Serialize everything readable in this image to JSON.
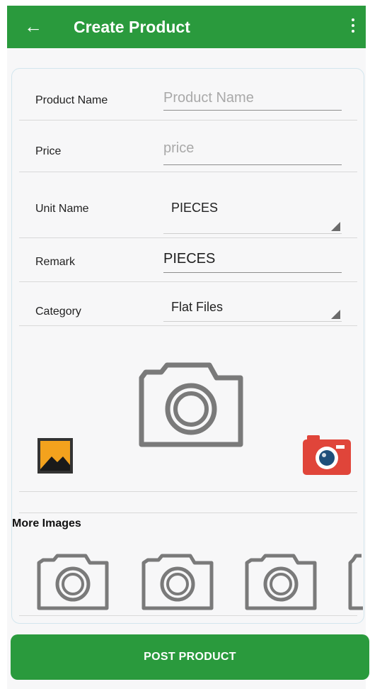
{
  "appbar": {
    "title": "Create Product",
    "back_icon": "arrow-left-icon",
    "menu_icon": "more-vert-icon",
    "color": "#2a9a3d"
  },
  "form": {
    "product_name": {
      "label": "Product Name",
      "placeholder": "Product Name",
      "value": ""
    },
    "price": {
      "label": "Price",
      "placeholder": "price",
      "value": ""
    },
    "unit_name": {
      "label": "Unit Name",
      "selected": "PIECES"
    },
    "remark": {
      "label": "Remark",
      "value": "PIECES"
    },
    "category": {
      "label": "Category",
      "selected": "Flat Files"
    }
  },
  "images": {
    "main_placeholder_icon": "camera-outline-icon",
    "gallery_icon": "gallery-picture-icon",
    "camera_button_icon": "red-camera-icon"
  },
  "more_images": {
    "title": "More Images",
    "thumb_icon": "camera-outline-icon"
  },
  "post_button": {
    "label": "POST PRODUCT",
    "color": "#2a9a3d"
  }
}
